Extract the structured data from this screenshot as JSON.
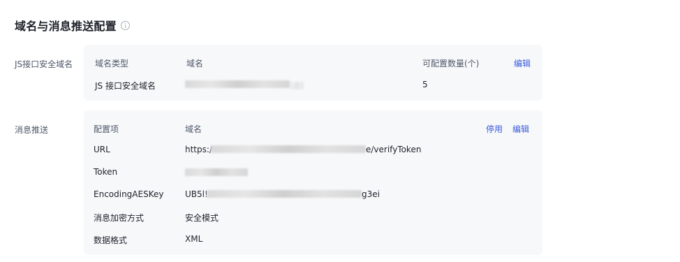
{
  "page": {
    "title": "域名与消息推送配置"
  },
  "js_section": {
    "label": "JS接口安全域名",
    "headers": {
      "type": "域名类型",
      "domain": "域名",
      "count": "可配置数量(个)"
    },
    "edit_label": "编辑",
    "row": {
      "type": "JS 接口安全域名",
      "count": "5"
    }
  },
  "push_section": {
    "label": "消息推送",
    "headers": {
      "item": "配置项",
      "domain": "域名"
    },
    "disable_label": "停用",
    "edit_label": "编辑",
    "rows": [
      {
        "key": "URL",
        "prefix": "https:/",
        "suffix": "e/verifyToken"
      },
      {
        "key": "Token",
        "prefix": "",
        "suffix": ""
      },
      {
        "key": "EncodingAESKey",
        "prefix": "UB5l!",
        "suffix": "g3ei"
      },
      {
        "key": "消息加密方式",
        "value": "安全模式"
      },
      {
        "key": "数据格式",
        "value": "XML"
      }
    ]
  }
}
